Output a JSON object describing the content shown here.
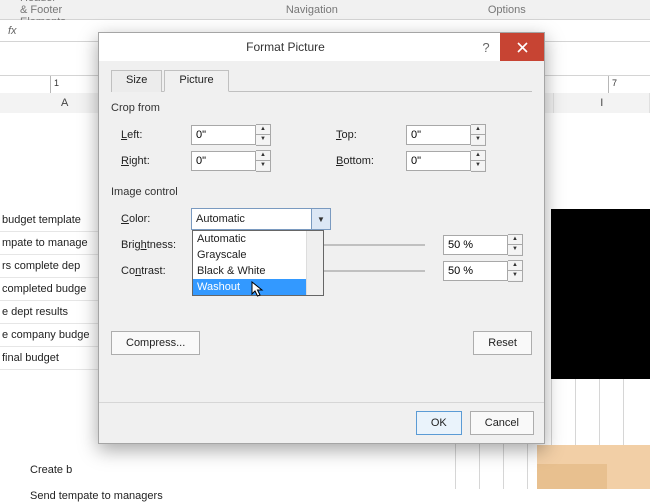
{
  "ribbon": {
    "headerFooter": "Header & Footer Elements",
    "navigation": "Navigation",
    "options": "Options"
  },
  "formulaBar": {
    "label": "fx"
  },
  "ruler": {
    "n1": "1",
    "n7": "7"
  },
  "columns": {
    "A": "A",
    "I": "I"
  },
  "tasks": [
    "budget template",
    "mpate to manage",
    "rs complete dep",
    "completed budge",
    "e dept results",
    "e company budge",
    "final budget"
  ],
  "bottomTasks": [
    "Create b",
    "Send tempate to managers"
  ],
  "dialog": {
    "title": "Format Picture",
    "tabs": [
      "Size",
      "Picture"
    ],
    "sections": {
      "crop": "Crop from",
      "image": "Image control"
    },
    "crop": {
      "leftLbl": "eft:",
      "rightLbl": "ight:",
      "topLbl": "op:",
      "bottomLbl": "ottom:",
      "left": "0\"",
      "right": "0\"",
      "top": "0\"",
      "bottom": "0\""
    },
    "image": {
      "colorLbl": "olor:",
      "colorValue": "Automatic",
      "colorOptions": [
        "Automatic",
        "Grayscale",
        "Black & White",
        "Washout"
      ],
      "brightLbl": "tness:",
      "brightness": "50 %",
      "contrastLbl": "trast:",
      "contrast": "50 %"
    },
    "buttons": {
      "compress": "Compress...",
      "reset": "Reset",
      "ok": "OK",
      "cancel": "Cancel"
    }
  }
}
